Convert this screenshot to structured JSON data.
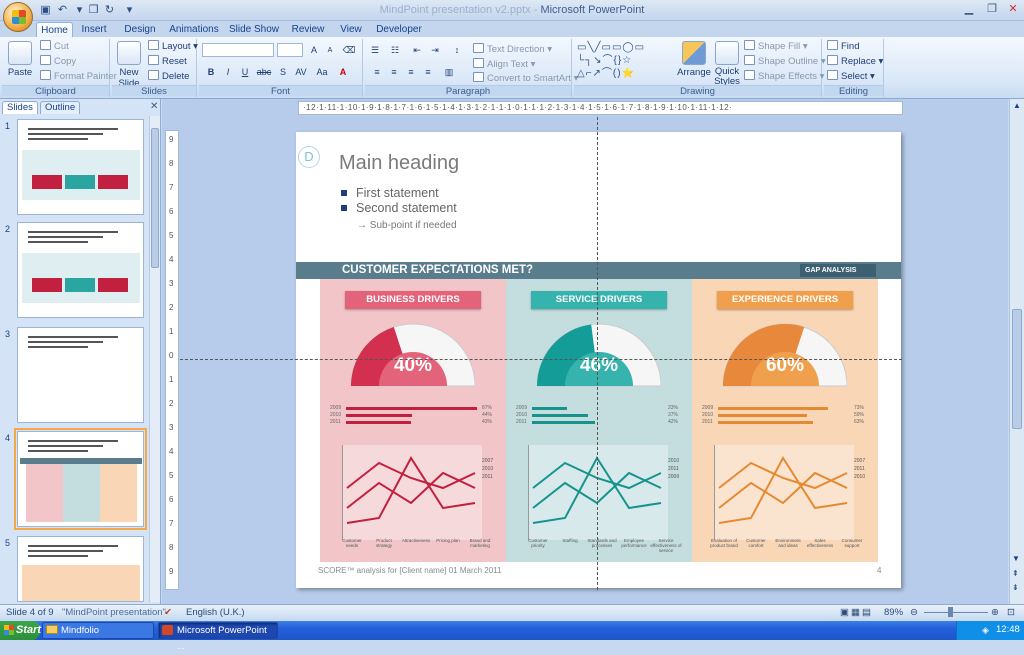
{
  "window": {
    "title": "Microsoft PowerPoint",
    "title_prefix": "MindPoint presentation v2.pptx - "
  },
  "ribbon_tabs": [
    "Home",
    "Insert",
    "Design",
    "Animations",
    "Slide Show",
    "Review",
    "View",
    "Developer"
  ],
  "clipboard": {
    "paste": "Paste",
    "cut": "Cut",
    "copy": "Copy",
    "format_painter": "Format Painter",
    "label": "Clipboard"
  },
  "slides_group": {
    "new_slide": "New Slide",
    "layout": "Layout",
    "reset": "Reset",
    "delete": "Delete",
    "label": "Slides"
  },
  "font_group": {
    "label": "Font",
    "bold": "B",
    "italic": "I",
    "underline": "U",
    "strike": "abc",
    "shadow": "S",
    "spacing": "AV",
    "case": "Aa",
    "grow": "A",
    "shrink": "A"
  },
  "paragraph_group": {
    "label": "Paragraph",
    "text_direction": "Text Direction",
    "align_text": "Align Text",
    "convert_smartart": "Convert to SmartArt"
  },
  "drawing_group": {
    "label": "Drawing",
    "arrange": "Arrange",
    "quick_styles": "Quick Styles",
    "shape_fill": "Shape Fill",
    "shape_outline": "Shape Outline",
    "shape_effects": "Shape Effects"
  },
  "editing_group": {
    "label": "Editing",
    "find": "Find",
    "replace": "Replace",
    "select": "Select"
  },
  "panel_tabs": {
    "slides": "Slides",
    "outline": "Outline"
  },
  "thumbnails": [
    "1",
    "2",
    "3",
    "4",
    "5"
  ],
  "hruler_ticks": "·12·1·11·1·10·1·9·1·8·1·7·1·6·1·5·1·4·1·3·1·2·1·1·1·0·1·1·1·2·1·3·1·4·1·5·1·6·1·7·1·8·1·9·1·10·1·11·1·12·",
  "vruler_ticks": [
    "9",
    "8",
    "7",
    "6",
    "5",
    "4",
    "3",
    "2",
    "1",
    "0",
    "1",
    "2",
    "3",
    "4",
    "5",
    "6",
    "7",
    "8",
    "9"
  ],
  "slide": {
    "heading": "Main heading",
    "bullets": [
      "First statement",
      "Second statement"
    ],
    "subpoint": "→  Sub-point if needed",
    "band_title": "CUSTOMER EXPECTATIONS MET?",
    "band_tag": "GAP ANALYSIS",
    "footer": "SCORE™ analysis for [Client name] 01 March 2011",
    "page": "4",
    "columns": [
      {
        "title": "BUSINESS DRIVERS",
        "percent": "40%",
        "value": 0.4,
        "bg": "#f2c5c8",
        "accent": "#d2304e",
        "pill": "#e2637a",
        "lines": "#c2203f",
        "years": [
          "2009",
          "2010",
          "2011"
        ],
        "vals": [
          "87%",
          "44%",
          "43%"
        ],
        "xlabels": [
          "Customer needs",
          "Product strategy",
          "Attractiveness",
          "Pricing plan",
          "Brand and marketing"
        ],
        "legend": [
          "2007",
          "2010",
          "2011"
        ]
      },
      {
        "title": "SERVICE DRIVERS",
        "percent": "46%",
        "value": 0.46,
        "bg": "#c4dee0",
        "accent": "#139c98",
        "pill": "#37b3ad",
        "lines": "#17938e",
        "years": [
          "2009",
          "2010",
          "2011"
        ],
        "vals": [
          "23%",
          "37%",
          "42%"
        ],
        "xlabels": [
          "Customer priority",
          "Staffing",
          "Standards and processes",
          "Employee performance",
          "Service effectiveness of service"
        ],
        "legend": [
          "2010",
          "2011",
          "2009"
        ]
      },
      {
        "title": "EXPERIENCE DRIVERS",
        "percent": "60%",
        "value": 0.6,
        "bg": "#f8d6b6",
        "accent": "#e8883b",
        "pill": "#f0a04d",
        "lines": "#e58a33",
        "years": [
          "2009",
          "2010",
          "2011"
        ],
        "vals": [
          "73%",
          "59%",
          "63%"
        ],
        "xlabels": [
          "Evaluation of product brand",
          "Customer comfort",
          "Environment and ideas",
          "Sales effectiveness",
          "Consumer support"
        ],
        "legend": [
          "2007",
          "2011",
          "2010"
        ]
      }
    ]
  },
  "status": {
    "slide": "Slide 4 of 9",
    "theme": "\"MindPoint presentation\"",
    "lang": "English (U.K.)",
    "zoom": "89%"
  },
  "taskbar": {
    "start": "Start",
    "item1": "Mindfolio",
    "item2": "Microsoft PowerPoint ...",
    "lang": "EN",
    "clock": "12:48"
  }
}
